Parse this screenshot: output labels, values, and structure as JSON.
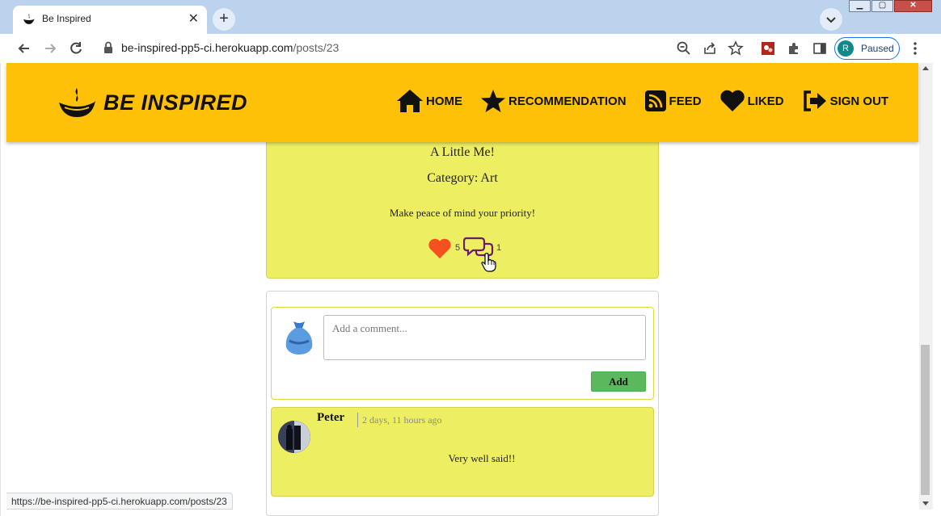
{
  "browser": {
    "tab_title": "Be Inspired",
    "url_host": "be-inspired-pp5-ci.herokuapp.com",
    "url_path": "/posts/23",
    "profile_initial": "R",
    "profile_status": "Paused",
    "status_url": "https://be-inspired-pp5-ci.herokuapp.com/posts/23"
  },
  "navbar": {
    "brand": "BE INSPIRED",
    "links": [
      {
        "label": "HOME",
        "icon": "home-icon"
      },
      {
        "label": "RECOMMENDATION",
        "icon": "star-icon"
      },
      {
        "label": "FEED",
        "icon": "rss-icon"
      },
      {
        "label": "LIKED",
        "icon": "heart-icon"
      },
      {
        "label": "SIGN OUT",
        "icon": "sign-out-icon"
      }
    ]
  },
  "post": {
    "title": "A Little Me!",
    "category": "Category: Art",
    "content": "Make peace of mind your priority!",
    "likes_count": "5",
    "comments_count": "1"
  },
  "comment_form": {
    "placeholder": "Add a comment...",
    "button_label": "Add"
  },
  "comments": [
    {
      "author": "Peter",
      "time": "2 days, 11 hours ago",
      "text": "Very well said!!"
    }
  ],
  "colors": {
    "navbar_bg": "#ffc107",
    "card_bg": "#eeee62",
    "heart": "#f4511e",
    "comment_icon": "#6a1b6e",
    "add_button": "#5cb85c"
  }
}
